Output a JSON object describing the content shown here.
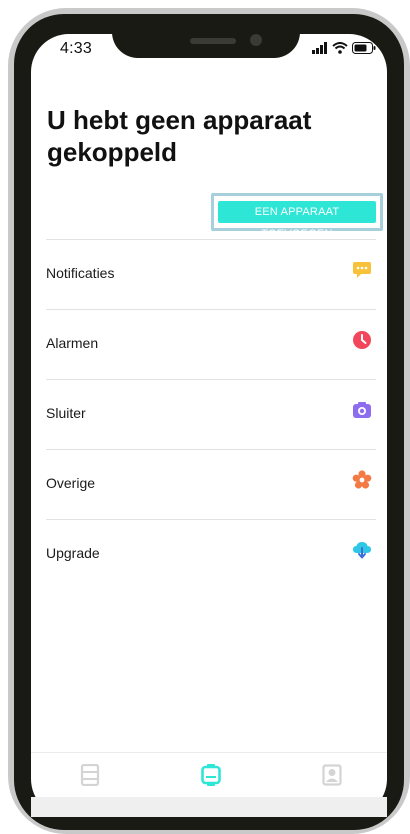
{
  "status_bar": {
    "time": "4:33"
  },
  "page": {
    "title": "U hebt geen apparaat gekoppeld"
  },
  "add_device_button": {
    "label": "EEN APPARAAT TOEVOEGEN"
  },
  "menu": {
    "items": [
      {
        "label": "Notificaties",
        "icon": "chat-bubble-icon",
        "color": "#f7c23a"
      },
      {
        "label": "Alarmen",
        "icon": "clock-icon",
        "color": "#f2465a"
      },
      {
        "label": "Sluiter",
        "icon": "camera-icon",
        "color": "#8e6cf0"
      },
      {
        "label": "Overige",
        "icon": "flower-icon",
        "color": "#f37a45"
      },
      {
        "label": "Upgrade",
        "icon": "cloud-download-icon",
        "color": "#2ec8e6"
      }
    ]
  },
  "tab_bar": {
    "tabs": [
      {
        "icon": "phone-icon",
        "active": false
      },
      {
        "icon": "watch-icon",
        "active": true
      },
      {
        "icon": "profile-icon",
        "active": false
      }
    ]
  },
  "colors": {
    "accent": "#2ee6d6",
    "tab_inactive": "#d4d4d4",
    "button_outline": "#a7cfdc"
  }
}
